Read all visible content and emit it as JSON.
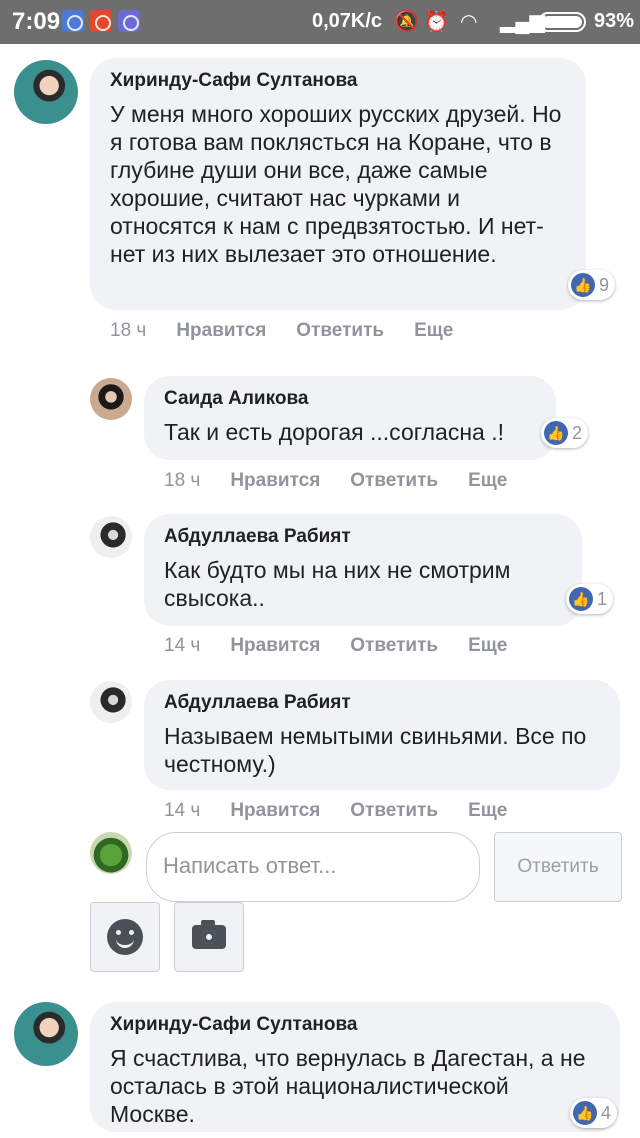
{
  "status_bar": {
    "time": "7:09",
    "speed": "0,07K/c",
    "battery": "93%",
    "icons": [
      "messenger-icon",
      "aliexpress-icon",
      "gallery-icon",
      "mute-icon",
      "alarm-icon",
      "wifi-icon",
      "signal-icon",
      "battery-icon"
    ]
  },
  "comments": [
    {
      "author": "Хиринду-Сафи Султанова",
      "text": "У меня много хороших русских друзей. Но я готова вам поклясться на Коране, что в глубине души они все, даже самые хорошие, считают нас чурками и относятся к нам с предвзятостью. И нет-нет из них вылезает это отношение.",
      "likes": "9",
      "time": "18 ч",
      "like_label": "Нравится",
      "reply_label": "Ответить",
      "more_label": "Еще"
    },
    {
      "author": "Саида Аликова",
      "text": "Так и есть дорогая ...согласна .!",
      "likes": "2",
      "time": "18 ч",
      "like_label": "Нравится",
      "reply_label": "Ответить",
      "more_label": "Еще"
    },
    {
      "author": "Абдуллаева Рабият",
      "text": "Как будто мы на них не смотрим свысока..",
      "likes": "1",
      "time": "14 ч",
      "like_label": "Нравится",
      "reply_label": "Ответить",
      "more_label": "Еще"
    },
    {
      "author": "Абдуллаева Рабият",
      "text": "Называем немытыми свиньями. Все по честному.)",
      "time": "14 ч",
      "like_label": "Нравится",
      "reply_label": "Ответить",
      "more_label": "Еще"
    },
    {
      "author": "Хиринду-Сафи Султанова",
      "text": "Я счастлива, что вернулась в Дагестан, а не осталась в этой националистической Москве.",
      "likes": "4"
    }
  ],
  "reply_box": {
    "placeholder": "Написать ответ...",
    "submit_label": "Ответить"
  },
  "like_icon_glyph": "👍",
  "colors": {
    "bubble": "#f1f2f5",
    "like_blue": "#4267b2",
    "meta_gray": "#90949c"
  }
}
